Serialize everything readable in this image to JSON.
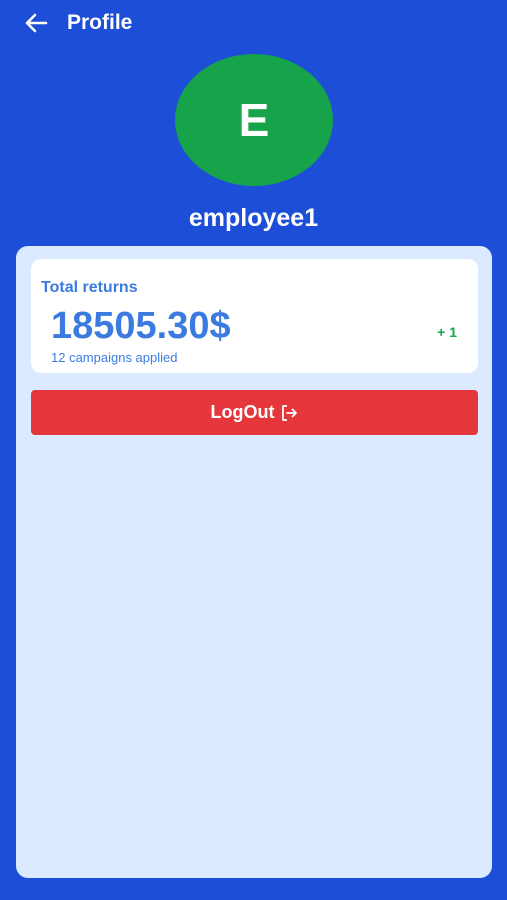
{
  "header": {
    "title": "Profile",
    "back_icon": "arrow-left-icon"
  },
  "profile": {
    "avatar_initial": "E",
    "username": "employee1",
    "avatar_color": "#16a34a"
  },
  "returns": {
    "label": "Total returns",
    "amount": "18505.30$",
    "campaigns_text": "12 campaigns applied",
    "delta": "+ 1"
  },
  "actions": {
    "logout_label": "LogOut",
    "logout_icon": "logout-icon"
  },
  "colors": {
    "background": "#1d4ed8",
    "panel": "#dbeafe",
    "accent_text": "#3b7be0",
    "positive": "#16a34a",
    "danger": "#e5373b"
  }
}
